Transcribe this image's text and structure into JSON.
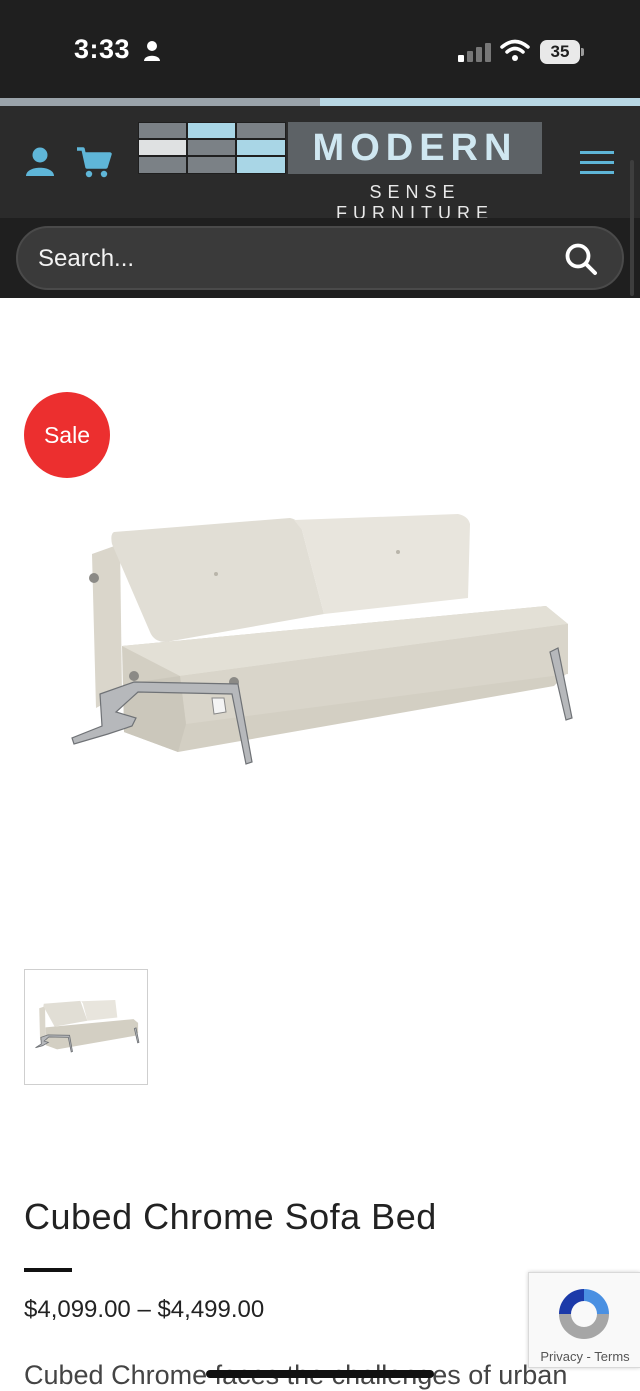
{
  "status_bar": {
    "time": "3:33",
    "battery": "35"
  },
  "header": {
    "logo_word": "MODERN",
    "logo_tagline": "SENSE FURNITURE",
    "accent_color": "#5fb6d8"
  },
  "search": {
    "placeholder": "Search..."
  },
  "product": {
    "badge": "Sale",
    "title": "Cubed Chrome Sofa Bed",
    "price": "$4,099.00 – $4,499.00",
    "description": "Cubed Chrome faces the challenges of urban"
  },
  "recaptcha": {
    "text": "Privacy - Terms"
  },
  "icons": [
    "person-icon",
    "signal-icon",
    "wifi-icon",
    "battery-icon",
    "account-icon",
    "cart-icon",
    "menu-icon",
    "search-icon",
    "recaptcha-icon"
  ]
}
